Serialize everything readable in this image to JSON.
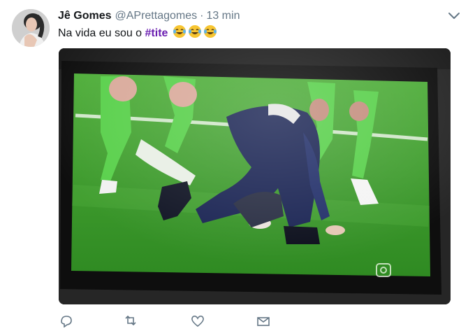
{
  "tweet": {
    "author_name": "Jê Gomes",
    "handle": "@APrettagomes",
    "separator": "·",
    "timestamp": "13 min",
    "text_prefix": "Na vida eu sou o ",
    "hashtag": "#tite",
    "emojis": [
      "laughing-tears-emoji",
      "laughing-tears-emoji",
      "laughing-tears-emoji"
    ]
  },
  "colors": {
    "hashtag": "#6b1fb1",
    "secondary_text": "#657786",
    "pitch_green": "#3f9a2c",
    "player_suit": "#1b2554"
  },
  "icons": {
    "menu": "chevron-down-icon",
    "actions": [
      "reply-icon",
      "retweet-icon",
      "like-icon",
      "direct-message-icon"
    ]
  }
}
